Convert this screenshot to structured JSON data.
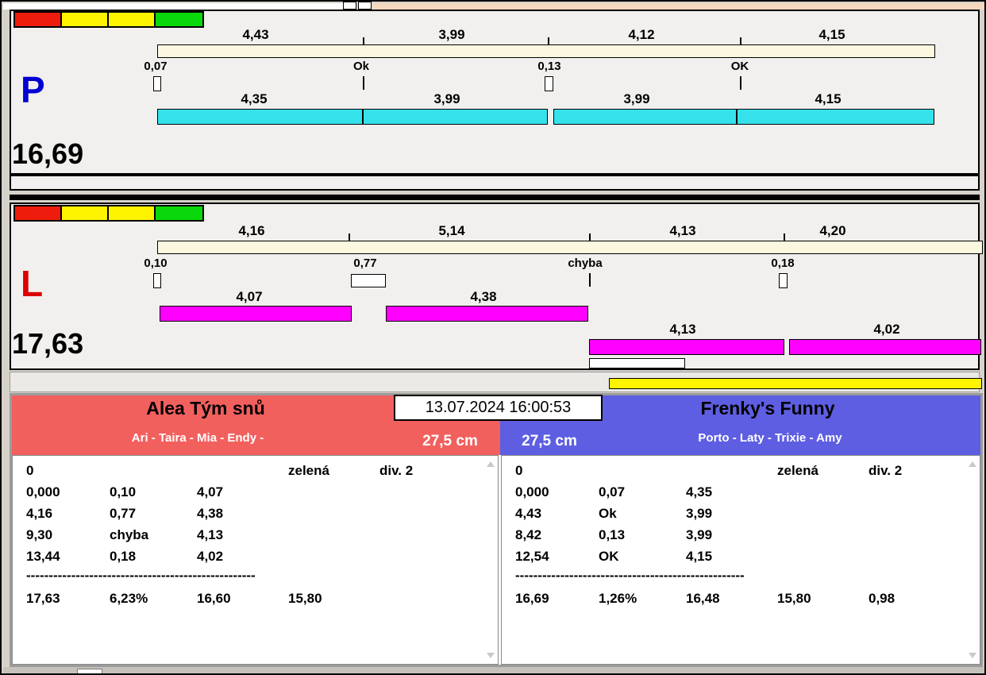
{
  "colors": {
    "lane_bar_cyan": "#35e2ec",
    "lane_bar_magenta": "#ff00ff",
    "split_track_cream": "#fcf8e0",
    "team_left_red": "#f2605e",
    "team_right_blue": "#5e5ee2",
    "light_red": "#ee1c0c",
    "light_yellow": "#fff400",
    "light_green": "#0ad80a",
    "lane_p_letter": "#0000d2",
    "lane_l_letter": "#dd0000",
    "highlight_yellow": "#fff400"
  },
  "lane_p": {
    "letter": "P",
    "total_time": "16,69",
    "upper_splits": [
      "4,43",
      "3,99",
      "4,12",
      "4,15"
    ],
    "change_marks": [
      "0,07",
      "Ok",
      "0,13",
      "OK"
    ],
    "lower_splits": [
      "4,35",
      "3,99",
      "3,99",
      "4,15"
    ]
  },
  "lane_l": {
    "letter": "L",
    "total_time": "17,63",
    "upper_splits": [
      "4,16",
      "5,14",
      "4,13",
      "4,20"
    ],
    "change_marks": [
      "0,10",
      "0,77",
      "chyba",
      "0,18"
    ],
    "lower_splits": [
      "4,07",
      "4,38",
      "4,13",
      "4,02"
    ]
  },
  "scoreboard": {
    "timestamp": "13.07.2024 16:00:53",
    "left": {
      "team_name": "Alea Tým snů",
      "dogs": "Ari - Taira - Mia - Endy -",
      "jump_height": "27,5 cm",
      "rows": [
        [
          "0",
          "",
          "",
          "zelená",
          "div. 2"
        ],
        [
          "0,000",
          "0,10",
          "4,07",
          "",
          ""
        ],
        [
          "4,16",
          "0,77",
          "4,38",
          "",
          ""
        ],
        [
          "9,30",
          "chyba",
          "4,13",
          "",
          ""
        ],
        [
          "13,44",
          "0,18",
          "4,02",
          "",
          ""
        ],
        [
          "---------------------------------------------------",
          "",
          "",
          "",
          ""
        ],
        [
          "17,63",
          "6,23%",
          "16,60",
          "15,80",
          ""
        ]
      ]
    },
    "right": {
      "team_name": "Frenky's Funny",
      "dogs": "Porto - Laty - Trixie - Amy",
      "jump_height": "27,5 cm",
      "rows": [
        [
          "0",
          "",
          "",
          "zelená",
          "div. 2"
        ],
        [
          "0,000",
          "0,07",
          "4,35",
          "",
          ""
        ],
        [
          "4,43",
          "Ok",
          "3,99",
          "",
          ""
        ],
        [
          "8,42",
          "0,13",
          "3,99",
          "",
          ""
        ],
        [
          "12,54",
          "OK",
          "4,15",
          "",
          ""
        ],
        [
          "---------------------------------------------------",
          "",
          "",
          "",
          ""
        ],
        [
          "16,69",
          "1,26%",
          "16,48",
          "15,80",
          "0,98"
        ]
      ]
    }
  }
}
